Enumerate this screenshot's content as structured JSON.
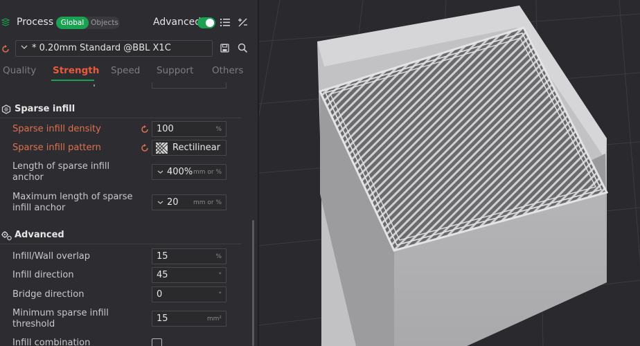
{
  "header": {
    "title": "Process",
    "mode_global": "Global",
    "mode_objects": "Objects",
    "advanced_label": "Advanced",
    "advanced_on": true
  },
  "preset": {
    "value": "* 0.20mm Standard @BBL X1C"
  },
  "tabs": [
    {
      "label": "Quality",
      "active": false
    },
    {
      "label": "Strength",
      "active": true
    },
    {
      "label": "Speed",
      "active": false
    },
    {
      "label": "Support",
      "active": false
    },
    {
      "label": "Others",
      "active": false
    }
  ],
  "sections": {
    "sparse_infill": {
      "title": "Sparse infill",
      "density": {
        "label": "Sparse infill density",
        "value": "100",
        "unit": "%"
      },
      "pattern": {
        "label": "Sparse infill pattern",
        "value": "Rectilinear"
      },
      "anchor_length": {
        "label": "Length of sparse infill anchor",
        "value": "400%",
        "unit": "mm or %"
      },
      "anchor_max": {
        "label": "Maximum length of sparse infill anchor",
        "value": "20",
        "unit": "mm or %"
      }
    },
    "advanced": {
      "title": "Advanced",
      "overlap": {
        "label": "Infill/Wall overlap",
        "value": "15",
        "unit": "%"
      },
      "direction": {
        "label": "Infill direction",
        "value": "45",
        "unit": "°"
      },
      "bridge": {
        "label": "Bridge direction",
        "value": "0",
        "unit": "°"
      },
      "min_threshold": {
        "label": "Minimum sparse infill threshold",
        "value": "15",
        "unit": "mm²"
      },
      "combination": {
        "label": "Infill combination",
        "checked": false
      }
    }
  },
  "colors": {
    "accent_green": "#1aa152",
    "modified_orange": "#e0704e",
    "active_tab": "#e85a3c"
  }
}
